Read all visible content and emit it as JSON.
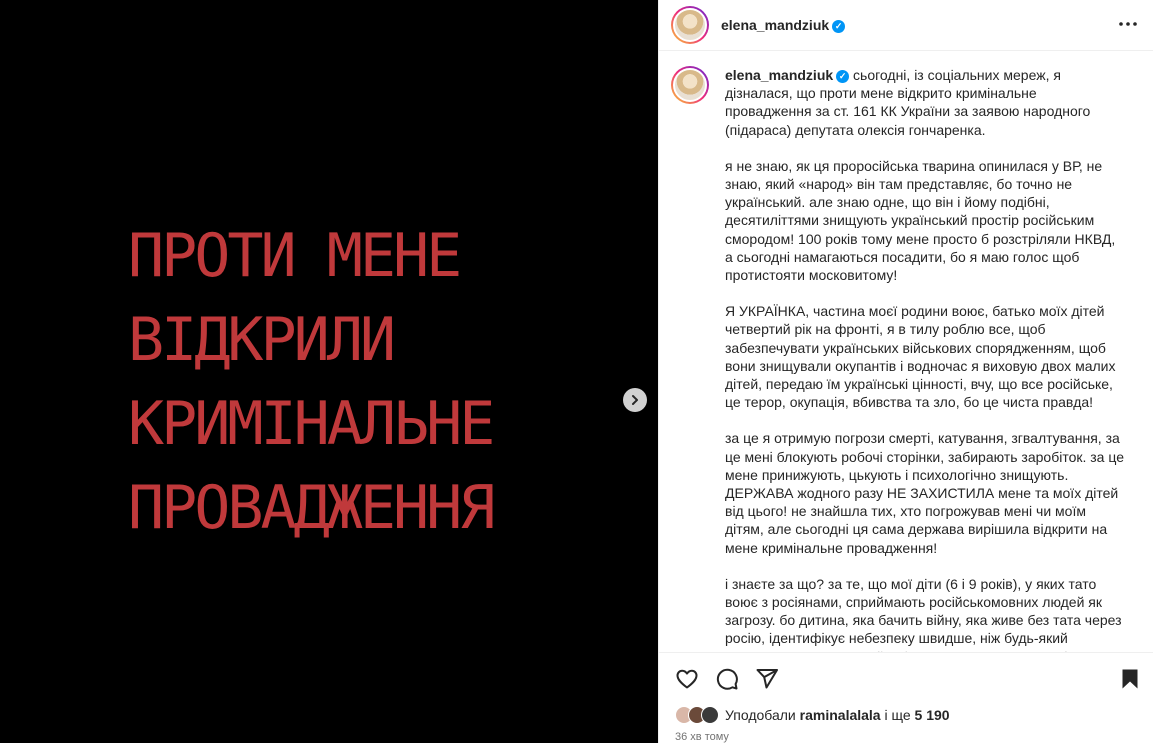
{
  "media": {
    "text_lines": [
      "ПРОТИ МЕНЕ",
      "ВІДКРИЛИ",
      "КРИМІНАЛЬНЕ",
      "ПРОВАДЖЕННЯ"
    ],
    "text_color": "#c0393b",
    "next_icon": "chevron-right-icon"
  },
  "header": {
    "username": "elena_mandziuk",
    "verified_icon": "verified-badge-icon",
    "more_icon": "more-options-icon"
  },
  "caption": {
    "username": "elena_mandziuk",
    "paragraphs": [
      "сьогодні, із соціальних мереж, я дізналася, що проти мене відкрито кримінальне провадження за ст. 161 КК України за заявою народного (підараса) депутата олексія гончаренка.",
      "я не знаю, як ця проросійська тварина опинилася у ВР, не знаю, який «народ» він там представляє, бо точно не український. але знаю одне, що він і йому подібні, десятиліттями знищують український простір російським смородом! 100 років тому мене просто б розстріляли НКВД, а сьогодні намагаються посадити, бо я маю голос щоб протистояти московитому!",
      "Я УКРАЇНКА, частина моєї родини воює, батько моїх дітей четвертий рік на фронті, я в тилу роблю все, щоб забезпечувати українських військових спорядженням, щоб вони знищували окупантів і водночас я виховую двох малих дітей, передаю їм українські цінності, вчу, що все російське, це терор, окупація, вбивства та зло, бо це чиста правда!",
      "за це я отримую погрози смерті, катування, згвалтування, за це мені блокують робочі сторінки, забирають заробіток. за це мене принижують, цькують і психологічно знищують. ДЕРЖАВА жодного разу НЕ ЗАХИСТИЛА мене та моїх дітей від цього! не знайшла тих, хто погрожував мені чи моїм дітям, але сьогодні ця сама держава вирішила відкрити на мене кримінальне провадження!",
      "і знаєте за що? за те, що мої діти (6 і 9 років), у яких тато воює з росіянами, сприймають російськомовних людей як загрозу. бо дитина, яка бачить війну, яка живе без тата через росію, ідентифікує небезпеку швидше, ніж будь-який чиновник у теплому кабінеті. якщо мене чи тата не буде поруч, вони"
    ]
  },
  "actions": {
    "like_icon": "heart-icon",
    "comment_icon": "comment-icon",
    "share_icon": "share-icon",
    "save_icon": "bookmark-icon"
  },
  "likes": {
    "prefix": "Уподобали",
    "user": "raminalalala",
    "middle": "і ще",
    "count": "5 190"
  },
  "time": "36 хв тому"
}
